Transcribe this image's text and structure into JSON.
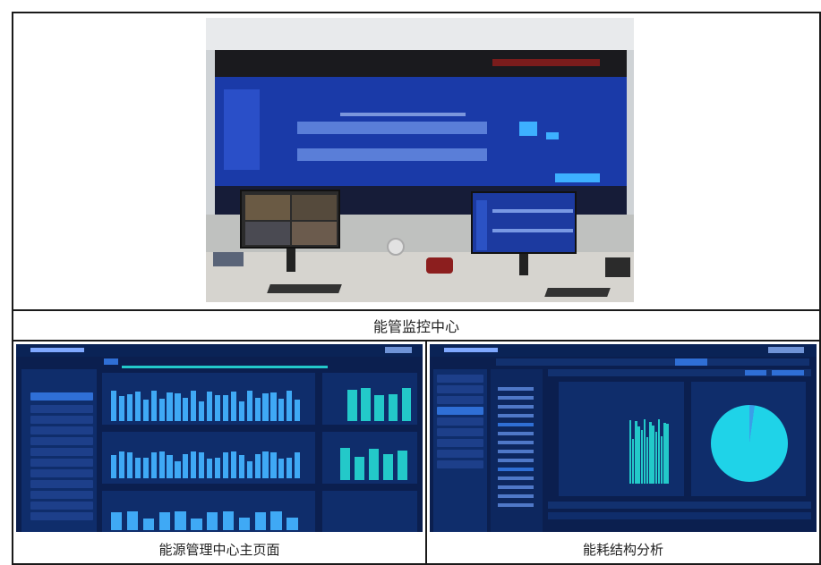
{
  "captions": {
    "top": "能管监控中心",
    "bottom_left": "能源管理中心主页面",
    "bottom_right": "能耗结构分析"
  },
  "icons": {
    "phone": "phone-icon",
    "clock": "clock-icon",
    "monitor": "monitor-icon"
  },
  "colors": {
    "dashboard_bg": "#0b1f4f",
    "panel_bg": "#0f2d6b",
    "bar_blue": "#3fa9f5",
    "bar_teal": "#23c9c9",
    "pie_cyan": "#1fd3e8"
  }
}
